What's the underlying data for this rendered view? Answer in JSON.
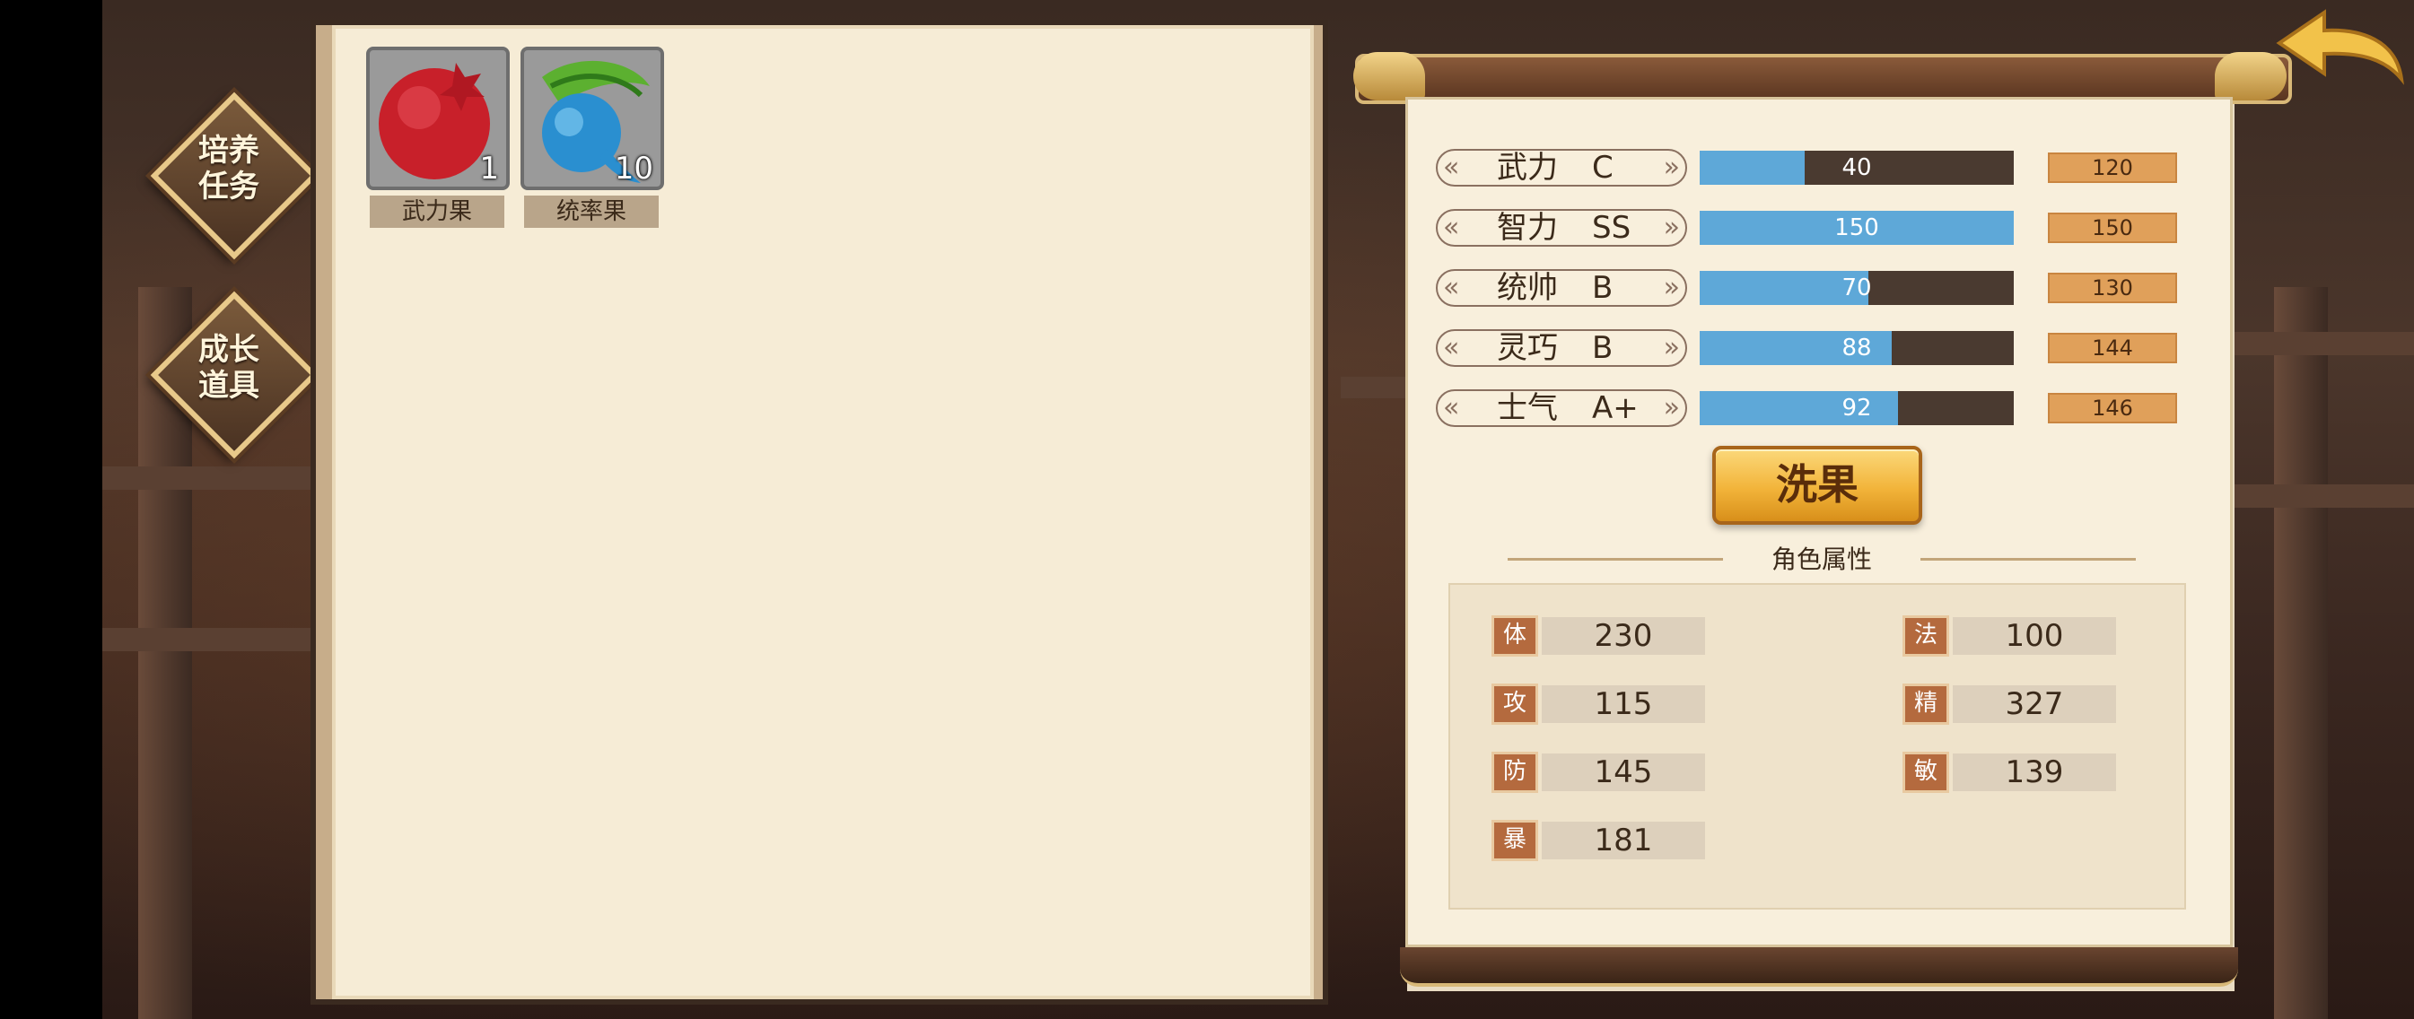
{
  "side_tabs": [
    {
      "label": "培养\n任务"
    },
    {
      "label": "成长\n道具"
    }
  ],
  "inventory": {
    "items": [
      {
        "name": "武力果",
        "count": "1"
      },
      {
        "name": "统率果",
        "count": "10"
      }
    ]
  },
  "stats": [
    {
      "name": "武力",
      "grade": "C",
      "value": "40",
      "max": "120",
      "fill": 0.333
    },
    {
      "name": "智力",
      "grade": "SS",
      "value": "150",
      "max": "150",
      "fill": 1.0
    },
    {
      "name": "统帅",
      "grade": "B",
      "value": "70",
      "max": "130",
      "fill": 0.538
    },
    {
      "name": "灵巧",
      "grade": "B",
      "value": "88",
      "max": "144",
      "fill": 0.611
    },
    {
      "name": "士气",
      "grade": "A+",
      "value": "92",
      "max": "146",
      "fill": 0.63
    }
  ],
  "wash_button": {
    "label": "洗果"
  },
  "attributes": {
    "title": "角色属性",
    "items": [
      {
        "icon": "体",
        "value": "230"
      },
      {
        "icon": "法",
        "value": "100"
      },
      {
        "icon": "攻",
        "value": "115"
      },
      {
        "icon": "精",
        "value": "327"
      },
      {
        "icon": "防",
        "value": "145"
      },
      {
        "icon": "敏",
        "value": "139"
      },
      {
        "icon": "暴",
        "value": "181"
      }
    ]
  },
  "colors": {
    "bar_fill": "#5ea8d8",
    "bar_track": "#4a3a30",
    "max_badge": "#e0a05a",
    "button_gold": "#f2b43a"
  }
}
